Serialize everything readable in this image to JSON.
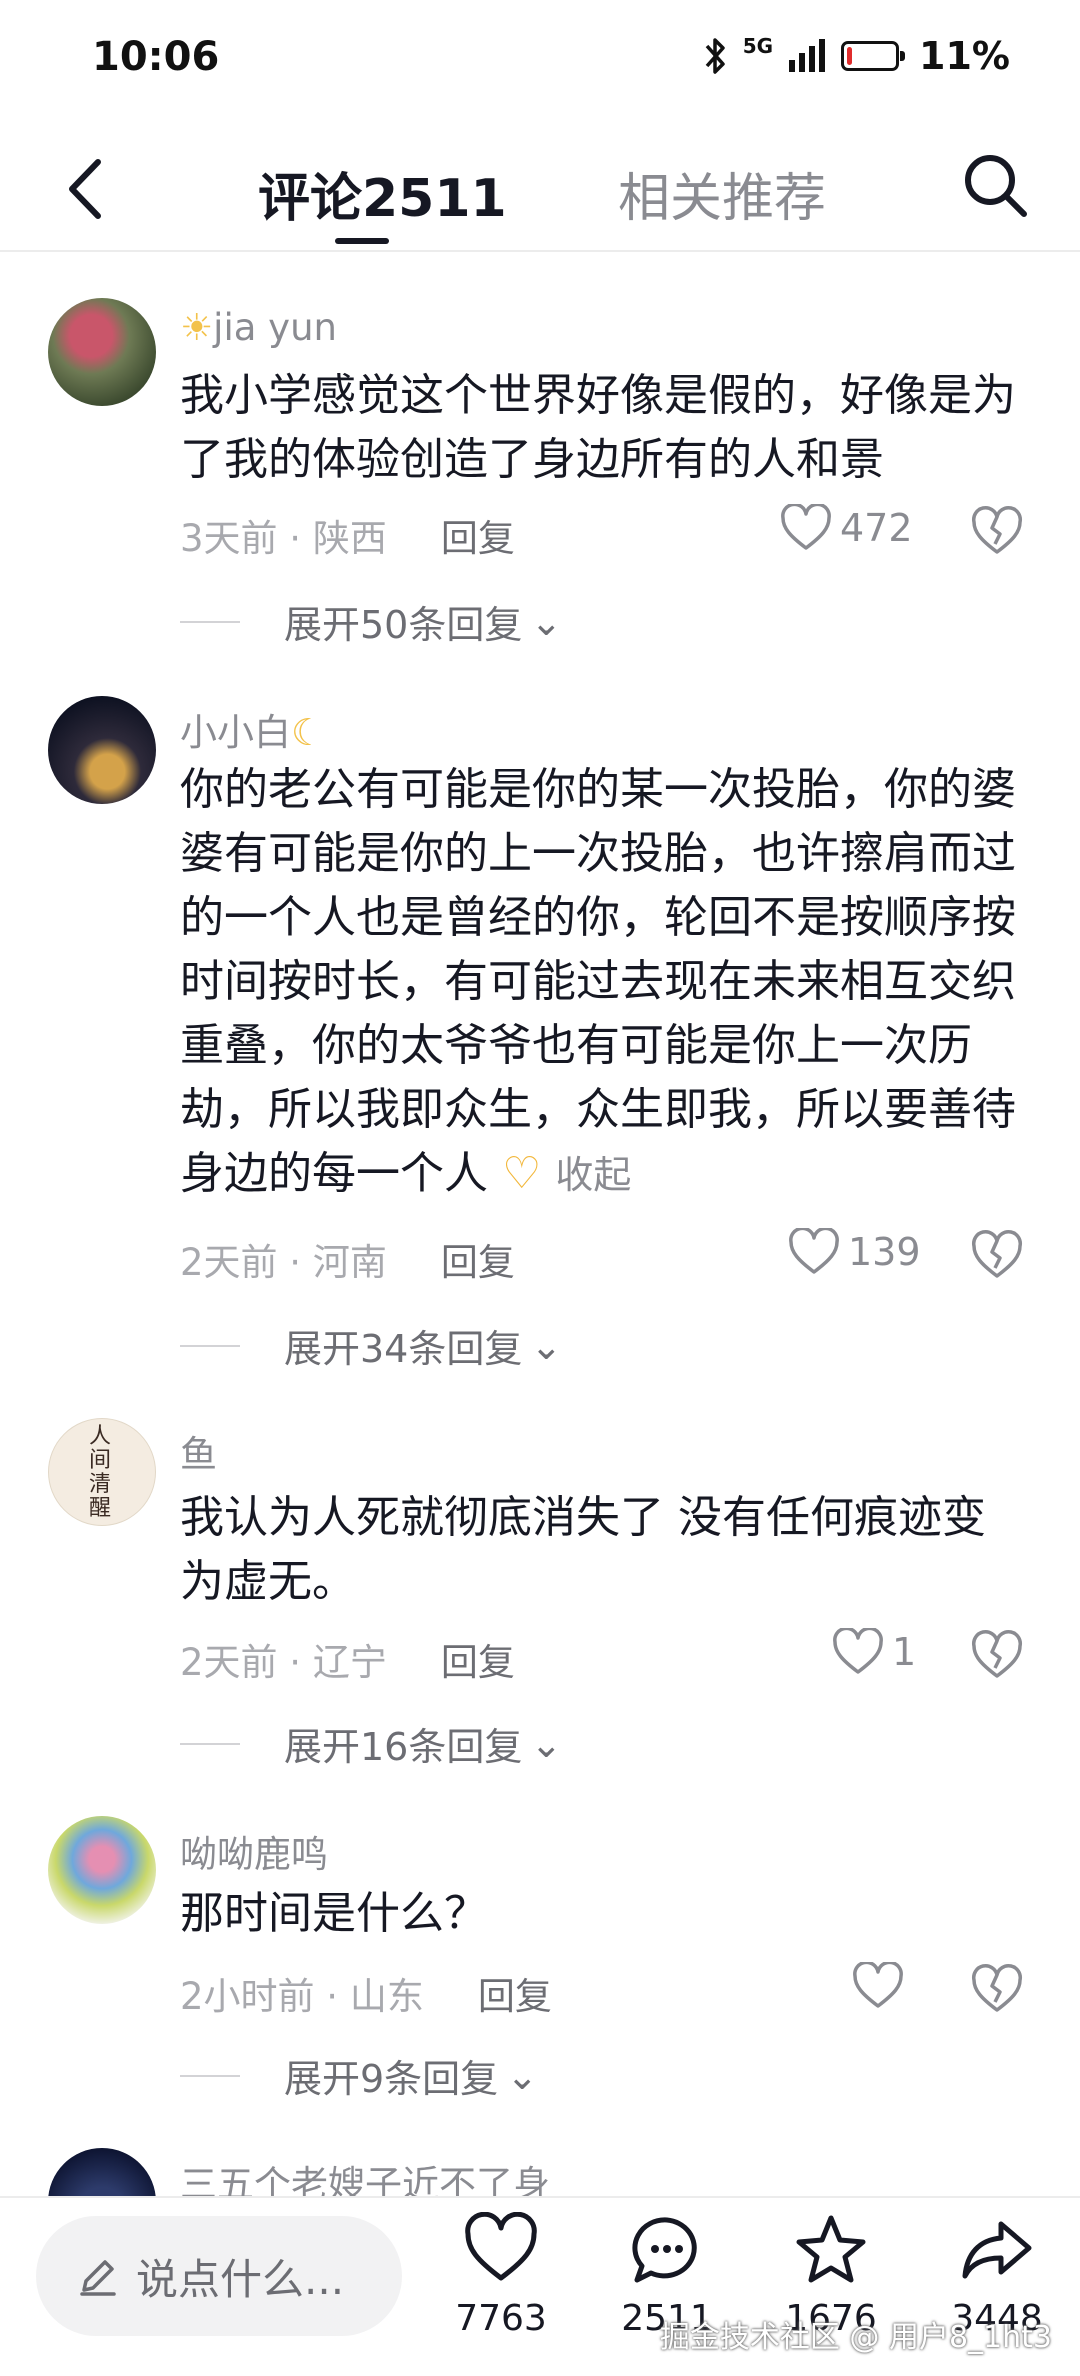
{
  "status_bar": {
    "time": "10:06",
    "network": "5G",
    "battery": "11%",
    "battery_level": 0.11
  },
  "header": {
    "tab_comments": "评论2511",
    "tab_related": "相关推荐"
  },
  "comments": [
    {
      "username": "jia yun",
      "text": "我小学感觉这个世界好像是假的，好像是为了我的体验创造了身边所有的人和景",
      "time_location": "3天前 · 陕西",
      "reply": "回复",
      "likes": "472",
      "expand": "展开50条回复"
    },
    {
      "username": "小小白",
      "text": "你的老公有可能是你的某一次投胎，你的婆婆有可能是你的上一次投胎，也许擦肩而过的一个人也是曾经的你，轮回不是按顺序按时间按时长，有可能过去现在未来相互交织重叠，你的太爷爷也有可能是你上一次历劫，所以我即众生，众生即我，所以要善待身边的每一个人",
      "collapse": "收起",
      "time_location": "2天前 · 河南",
      "reply": "回复",
      "likes": "139",
      "expand": "展开34条回复"
    },
    {
      "username": "鱼",
      "avatar_text": "人间清醒",
      "text": "我认为人死就彻底消失了 没有任何痕迹变为虚无。",
      "time_location": "2天前 · 辽宁",
      "reply": "回复",
      "likes": "1",
      "expand": "展开16条回复"
    },
    {
      "username": "呦呦鹿鸣",
      "text": "那时间是什么？",
      "time_location": "2小时前 · 山东",
      "reply": "回复",
      "likes": "",
      "expand": "展开9条回复"
    },
    {
      "username": "三五个老嫂子近不了身"
    }
  ],
  "bottom_bar": {
    "input_placeholder": "说点什么...",
    "likes": "7763",
    "comments": "2511",
    "favorites": "1676",
    "shares": "3448",
    "watermark": "掘金技术社区 @ 用户8_1ht3"
  }
}
